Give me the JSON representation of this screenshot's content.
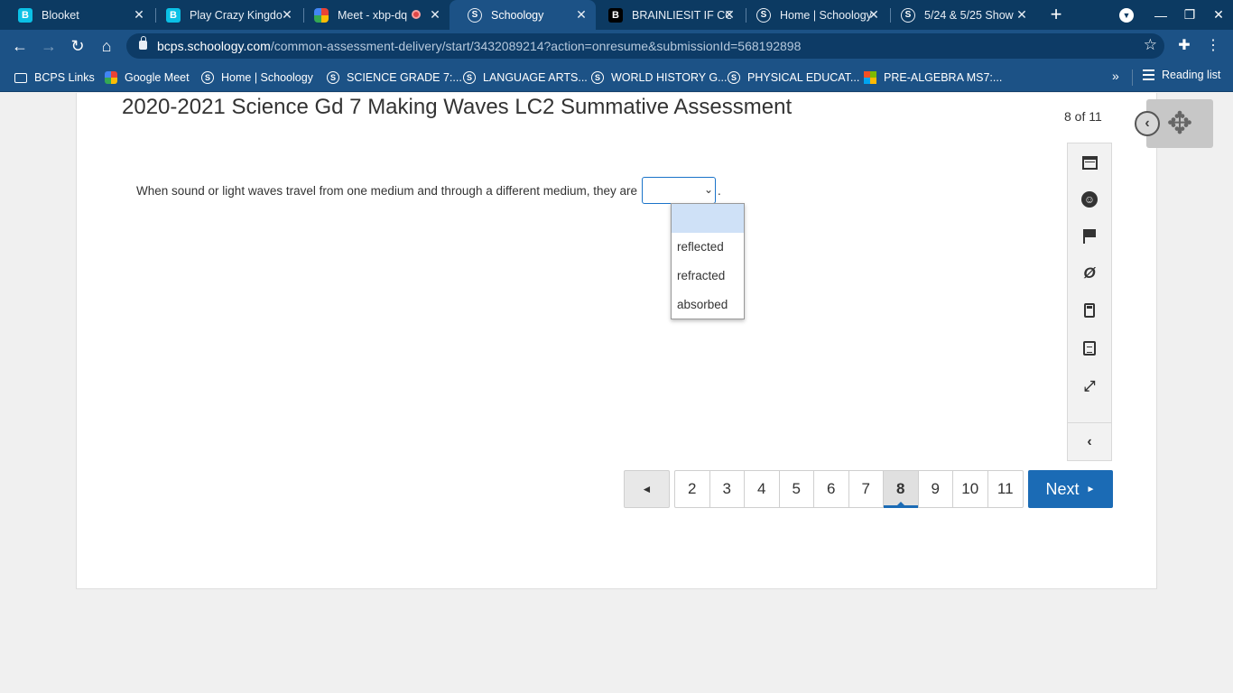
{
  "browser": {
    "tabs": [
      {
        "title": "Blooket",
        "icon": "blooket-icon"
      },
      {
        "title": "Play Crazy Kingdo",
        "icon": "blooket-icon"
      },
      {
        "title": "Meet - xbp-dq",
        "icon": "google-meet-icon"
      },
      {
        "title": "Schoology",
        "icon": "schoology-icon"
      },
      {
        "title": "BRAINLIESIT IF CO",
        "icon": "brainly-icon"
      },
      {
        "title": "Home | Schoology",
        "icon": "schoology-icon"
      },
      {
        "title": "5/24 & 5/25 Show",
        "icon": "schoology-icon"
      }
    ],
    "url_host": "bcps.schoology.com",
    "url_path": "/common-assessment-delivery/start/3432089214?action=onresume&submissionId=568192898",
    "bookmarks": [
      {
        "label": "BCPS Links",
        "icon": "folder-icon"
      },
      {
        "label": "Google Meet",
        "icon": "google-meet-icon"
      },
      {
        "label": "Home | Schoology",
        "icon": "schoology-icon"
      },
      {
        "label": "SCIENCE GRADE 7:...",
        "icon": "schoology-icon"
      },
      {
        "label": "LANGUAGE ARTS...",
        "icon": "schoology-icon"
      },
      {
        "label": "WORLD HISTORY G...",
        "icon": "schoology-icon"
      },
      {
        "label": "PHYSICAL EDUCAT...",
        "icon": "schoology-icon"
      },
      {
        "label": "PRE-ALGEBRA MS7:...",
        "icon": "microsoft-icon"
      }
    ],
    "more_bookmarks": "»",
    "reading_list": "Reading list"
  },
  "assessment": {
    "title": "2020-2021 Science Gd 7 Making Waves LC2 Summative Assessment",
    "counter": "8 of 11",
    "question_text": "When sound or light waves travel from one medium and through a different medium, they are",
    "question_end": ".",
    "dropdown_options": [
      "",
      "reflected",
      "refracted",
      "absorbed"
    ]
  },
  "pagination": {
    "prev": "◄",
    "pages": [
      "2",
      "3",
      "4",
      "5",
      "6",
      "7",
      "8",
      "9",
      "10",
      "11"
    ],
    "current": "8",
    "next": "Next",
    "next_arrow": "►"
  },
  "colors": {
    "browser_frame": "#1c5286",
    "tab_strip": "#0c3a62",
    "accent": "#1b6bb5"
  }
}
